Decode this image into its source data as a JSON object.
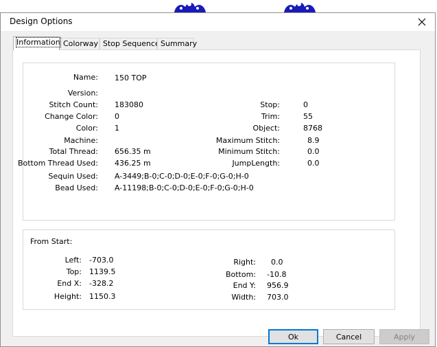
{
  "dialog": {
    "title": "Design Options"
  },
  "tabs": [
    {
      "label": "Information",
      "active": true
    },
    {
      "label": "Colorway",
      "active": false
    },
    {
      "label": "Stop Sequence",
      "active": false
    },
    {
      "label": "Summary",
      "active": false
    }
  ],
  "info": {
    "name": {
      "label": "Name:",
      "value": "150 TOP"
    },
    "version": {
      "label": "Version:",
      "value": ""
    },
    "stitch_count": {
      "label": "Stitch Count:",
      "value": "183080"
    },
    "change_color": {
      "label": "Change Color:",
      "value": "0"
    },
    "color": {
      "label": "Color:",
      "value": "1"
    },
    "machine": {
      "label": "Machine:",
      "value": ""
    },
    "total_thread": {
      "label": "Total Thread:",
      "value": "656.35 m"
    },
    "bottom_thread": {
      "label": "Bottom Thread Used:",
      "value": "436.25 m"
    },
    "sequin_used": {
      "label": "Sequin Used:",
      "value": "A-3449;B-0;C-0;D-0;E-0;F-0;G-0;H-0"
    },
    "bead_used": {
      "label": "Bead Used:",
      "value": "A-11198;B-0;C-0;D-0;E-0;F-0;G-0;H-0"
    },
    "stop": {
      "label": "Stop:",
      "value": "0"
    },
    "trim": {
      "label": "Trim:",
      "value": "55"
    },
    "object": {
      "label": "Object:",
      "value": "8768"
    },
    "max_stitch": {
      "label": "Maximum Stitch:",
      "value": "8.9"
    },
    "min_stitch": {
      "label": "Minimum Stitch:",
      "value": "0.0"
    },
    "jump_length": {
      "label": "JumpLength:",
      "value": "0.0"
    }
  },
  "from_start": {
    "header": "From Start:",
    "left": {
      "label": "Left:",
      "value": "-703.0"
    },
    "top": {
      "label": "Top:",
      "value": "1139.5"
    },
    "end_x": {
      "label": "End X:",
      "value": "-328.2"
    },
    "height": {
      "label": "Height:",
      "value": "1150.3"
    },
    "right": {
      "label": "Right:",
      "value": "0.0"
    },
    "bottom": {
      "label": "Bottom:",
      "value": "-10.8"
    },
    "end_y": {
      "label": "End Y:",
      "value": "956.9"
    },
    "width": {
      "label": "Width:",
      "value": "703.0"
    }
  },
  "buttons": {
    "ok": "Ok",
    "cancel": "Cancel",
    "apply": "Apply"
  },
  "icons": {
    "close": "close-icon",
    "background": "embroidery-design-art"
  },
  "colors": {
    "accent": "#0078d7",
    "art": "#1a1ab8"
  }
}
